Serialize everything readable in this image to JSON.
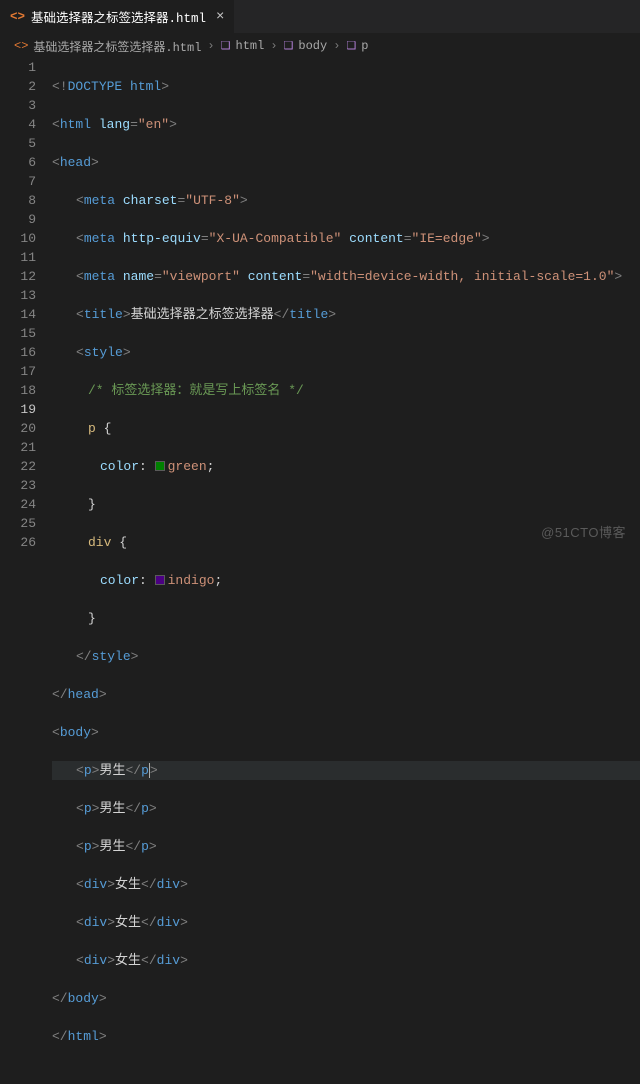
{
  "tab": {
    "filename": "基础选择器之标签选择器.html",
    "close": "×"
  },
  "breadcrumb": {
    "file": "基础选择器之标签选择器.html",
    "items": [
      "html",
      "body",
      "p"
    ],
    "sep": "›"
  },
  "line_numbers": [
    "1",
    "2",
    "3",
    "4",
    "5",
    "6",
    "7",
    "8",
    "9",
    "10",
    "11",
    "12",
    "13",
    "14",
    "15",
    "16",
    "17",
    "18",
    "19",
    "20",
    "21",
    "22",
    "23",
    "24",
    "25",
    "26"
  ],
  "active_line": 19,
  "code": {
    "doctype": "DOCTYPE",
    "doctype_name": "html",
    "lang_attr": "lang",
    "lang_val": "\"en\"",
    "charset_attr": "charset",
    "charset_val": "\"UTF-8\"",
    "httpequiv_attr": "http-equiv",
    "httpequiv_val": "\"X-UA-Compatible\"",
    "content_attr": "content",
    "ie_val": "\"IE=edge\"",
    "name_attr": "name",
    "viewport_val": "\"viewport\"",
    "viewport_content": "\"width=device-width, initial-scale=1.0\"",
    "title_text": "基础选择器之标签选择器",
    "comment": "/* 标签选择器：就是写上标签名 */",
    "sel_p": "p",
    "sel_div": "div",
    "prop_color": "color",
    "val_green": "green",
    "val_indigo": "indigo",
    "boy": "男生",
    "girl": "女生",
    "t_html": "html",
    "t_head": "head",
    "t_meta": "meta",
    "t_title": "title",
    "t_style": "style",
    "t_body": "body",
    "t_p": "p",
    "t_div": "div"
  },
  "watermark": "@51CTO博客"
}
